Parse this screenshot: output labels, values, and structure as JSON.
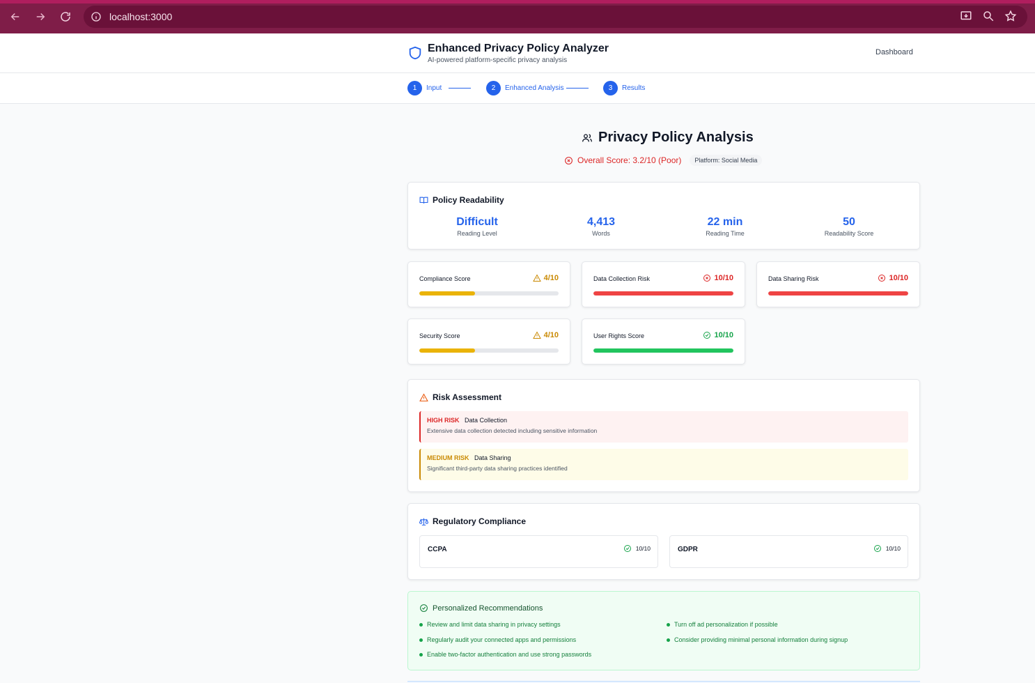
{
  "browser": {
    "url": "localhost:3000"
  },
  "header": {
    "title": "Enhanced Privacy Policy Analyzer",
    "subtitle": "AI-powered platform-specific privacy analysis",
    "nav_dashboard": "Dashboard"
  },
  "stepper": {
    "steps": [
      {
        "number": "1",
        "label": "Input"
      },
      {
        "number": "2",
        "label": "Enhanced Analysis"
      },
      {
        "number": "3",
        "label": "Results"
      }
    ]
  },
  "analysis": {
    "title": "Privacy Policy Analysis",
    "overall_score": "Overall Score: 3.2/10 (Poor)",
    "platform": "Platform: Social Media"
  },
  "readability": {
    "title": "Policy Readability",
    "stats": [
      {
        "value": "Difficult",
        "label": "Reading Level"
      },
      {
        "value": "4,413",
        "label": "Words"
      },
      {
        "value": "22 min",
        "label": "Reading Time"
      },
      {
        "value": "50",
        "label": "Readability Score"
      }
    ]
  },
  "scores": [
    {
      "label": "Compliance Score",
      "value": "4/10",
      "fraction": 0.4,
      "status": "warning",
      "color": "#eab308"
    },
    {
      "label": "Data Collection Risk",
      "value": "10/10",
      "fraction": 1.0,
      "status": "danger",
      "color": "#ef4444"
    },
    {
      "label": "Data Sharing Risk",
      "value": "10/10",
      "fraction": 1.0,
      "status": "danger",
      "color": "#ef4444"
    },
    {
      "label": "Security Score",
      "value": "4/10",
      "fraction": 0.4,
      "status": "warning",
      "color": "#eab308"
    },
    {
      "label": "User Rights Score",
      "value": "10/10",
      "fraction": 1.0,
      "status": "good",
      "color": "#22c55e"
    }
  ],
  "risk_assessment": {
    "title": "Risk Assessment",
    "items": [
      {
        "level": "HIGH RISK",
        "category": "Data Collection",
        "description": "Extensive data collection detected including sensitive information"
      },
      {
        "level": "MEDIUM RISK",
        "category": "Data Sharing",
        "description": "Significant third-party data sharing practices identified"
      }
    ]
  },
  "regulatory": {
    "title": "Regulatory Compliance",
    "items": [
      {
        "name": "CCPA",
        "score": "10/10"
      },
      {
        "name": "GDPR",
        "score": "10/10"
      }
    ]
  },
  "recommendations": {
    "title": "Personalized Recommendations",
    "items": [
      "Review and limit data sharing in privacy settings",
      "Turn off ad personalization if possible",
      "Regularly audit your connected apps and permissions",
      "Consider providing minimal personal information during signup",
      "Enable two-factor authentication and use strong passwords"
    ]
  },
  "colors": {
    "primary": "#2563eb",
    "danger": "#dc2626",
    "warning": "#ca8a04",
    "success": "#16a34a",
    "browser_frame": "#7f1d48"
  }
}
